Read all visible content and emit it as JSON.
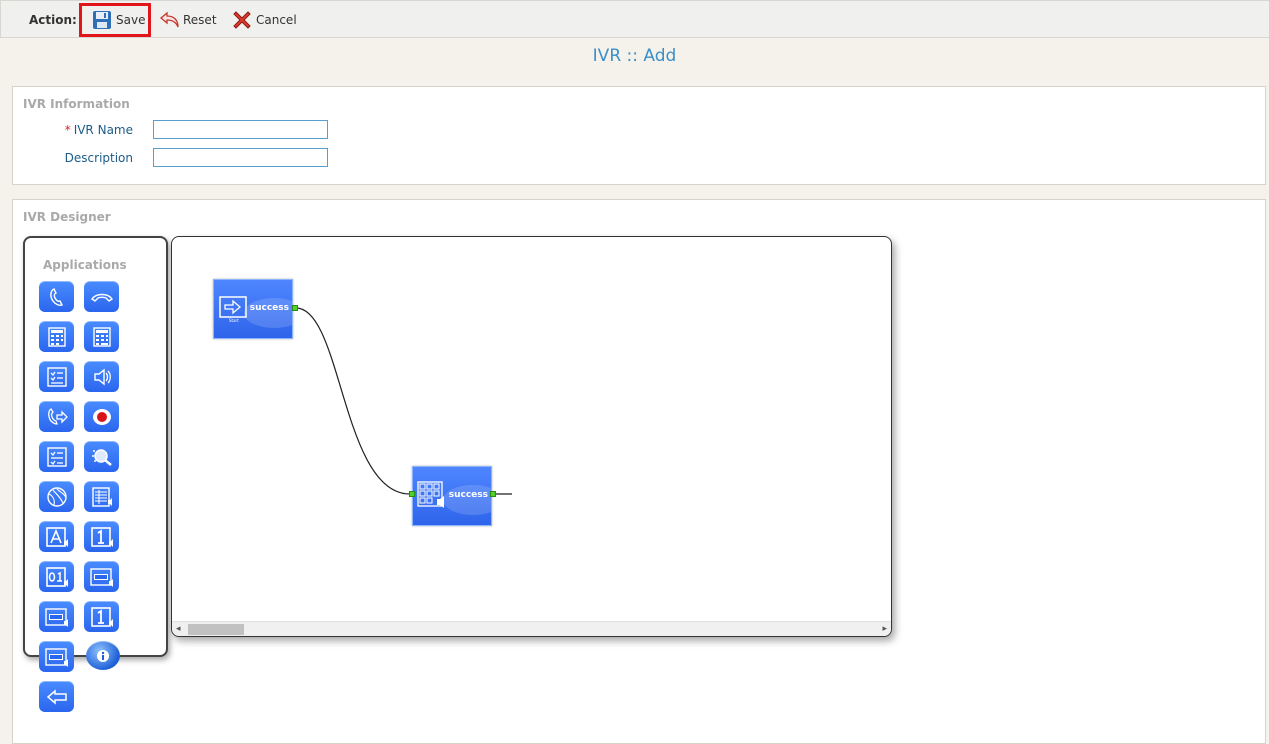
{
  "toolbar": {
    "action_label": "Action:",
    "save_label": "Save",
    "reset_label": "Reset",
    "cancel_label": "Cancel"
  },
  "page": {
    "title": "IVR :: Add"
  },
  "info": {
    "title": "IVR Information",
    "ivr_name_label": "IVR Name",
    "required_mark": "*",
    "ivr_name_value": "",
    "description_label": "Description",
    "description_value": ""
  },
  "designer": {
    "title": "IVR Designer",
    "palette_title": "Applications",
    "applications": [
      "phone-answer-icon",
      "hangup-icon",
      "keypad-icon",
      "calculator-icon",
      "checklist-icon",
      "speaker-icon",
      "call-transfer-icon",
      "record-icon",
      "menu-list-icon",
      "search-icon",
      "globe-icon",
      "table-icon",
      "say-alpha-icon",
      "say-number-icon",
      "say-digits-icon",
      "say-date-icon",
      "say-time-icon",
      "say-number-alt-icon",
      "say-time-alt-icon",
      "info-icon",
      "back-arrow-icon"
    ],
    "nodes": [
      {
        "kind": "start",
        "port_label": "success",
        "caption": "Start"
      },
      {
        "kind": "get-digits",
        "port_label": "success"
      }
    ]
  },
  "colors": {
    "accent": "#3a8fc9",
    "node": "#2e64ea",
    "port": "#4fd22c",
    "highlight": "#e0161b"
  }
}
